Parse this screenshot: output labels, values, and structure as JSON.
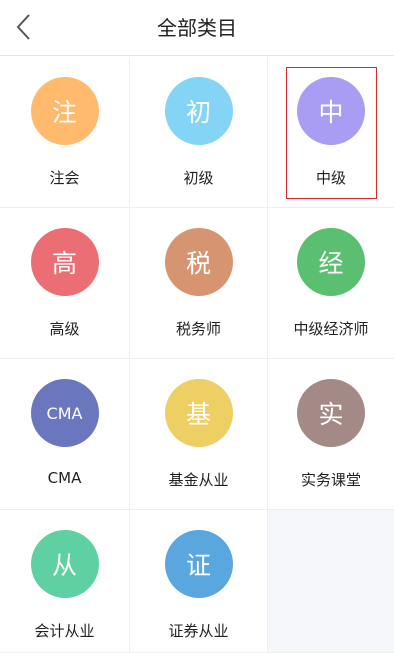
{
  "header": {
    "title": "全部类目"
  },
  "categories": [
    {
      "icon_text": "注",
      "label": "注会",
      "color": "#FFBA6E"
    },
    {
      "icon_text": "初",
      "label": "初级",
      "color": "#84D5F5"
    },
    {
      "icon_text": "中",
      "label": "中级",
      "color": "#A89DF2"
    },
    {
      "icon_text": "高",
      "label": "高级",
      "color": "#EA6E73"
    },
    {
      "icon_text": "税",
      "label": "税务师",
      "color": "#D69570"
    },
    {
      "icon_text": "经",
      "label": "中级经济师",
      "color": "#5BBF72"
    },
    {
      "icon_text": "CMA",
      "label": "CMA",
      "color": "#6A76BE"
    },
    {
      "icon_text": "基",
      "label": "基金从业",
      "color": "#EDCF63"
    },
    {
      "icon_text": "实",
      "label": "实务课堂",
      "color": "#A38A86"
    },
    {
      "icon_text": "从",
      "label": "会计从业",
      "color": "#5FD0A1"
    },
    {
      "icon_text": "证",
      "label": "证券从业",
      "color": "#5AA6DE"
    }
  ],
  "colors": {
    "selection_border": "#D6282E",
    "empty_cell_bg": "#F5F7FA"
  }
}
